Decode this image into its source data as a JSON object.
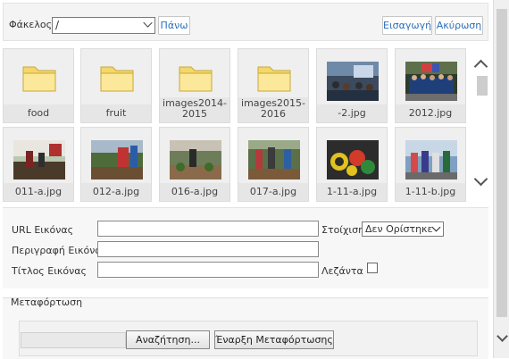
{
  "folder_bar": {
    "label": "Φάκελος",
    "current_folder": "/",
    "up_button": "Πάνω",
    "insert_button": "Εισαγωγή",
    "cancel_button": "Ακύρωση"
  },
  "items": [
    {
      "type": "folder",
      "name": "food"
    },
    {
      "type": "folder",
      "name": "fruit"
    },
    {
      "type": "folder",
      "name": "images2014-2015"
    },
    {
      "type": "folder",
      "name": "images2015-2016"
    },
    {
      "type": "image",
      "name": "-2.jpg"
    },
    {
      "type": "image",
      "name": "2012.jpg"
    },
    {
      "type": "image",
      "name": "011-a.jpg"
    },
    {
      "type": "image",
      "name": "012-a.jpg"
    },
    {
      "type": "image",
      "name": "016-a.jpg"
    },
    {
      "type": "image",
      "name": "017-a.jpg"
    },
    {
      "type": "image",
      "name": "1-11-a.jpg"
    },
    {
      "type": "image",
      "name": "1-11-b.jpg"
    }
  ],
  "form": {
    "url_label": "URL Εικόνας",
    "url_value": "",
    "align_label": "Στοίχιση",
    "align_value": "Δεν Ορίστηκε",
    "description_label": "Περιγραφή Εικόνας",
    "description_value": "",
    "title_label": "Τίτλος Εικόνας",
    "title_value": "",
    "caption_label": "Λεζάντα",
    "caption_checked": false
  },
  "upload": {
    "legend": "Μεταφόρτωση",
    "browse_button": "Αναζήτηση...",
    "start_button": "Έναρξη Μεταφόρτωσης"
  }
}
